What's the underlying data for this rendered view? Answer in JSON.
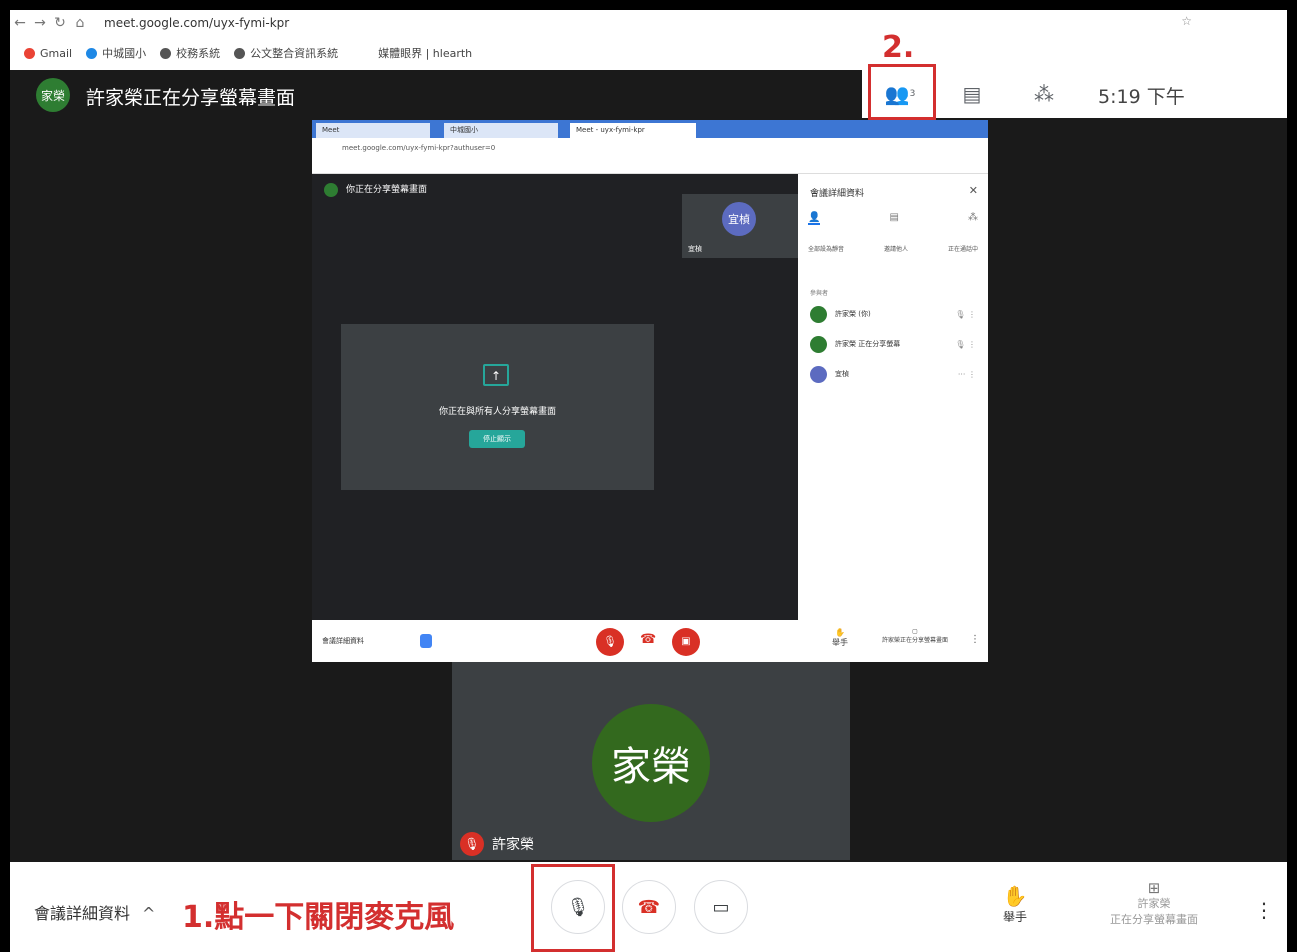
{
  "browser": {
    "url": "meet.google.com/uyx-fymi-kpr",
    "bookmarks": [
      "Gmail",
      "中城國小",
      "校務系統",
      "公文整合資訊系統",
      "媒體眼界 | hlearth"
    ]
  },
  "topbar": {
    "avatar_text": "家榮",
    "share_title": "許家榮正在分享螢幕畫面",
    "people_icon_badge": "3",
    "time": "5:19 下午",
    "annotation": "2."
  },
  "shared_screen": {
    "tab_labels": [
      "Meet",
      "中城國小",
      "Meet - uyx-fymi-kpr"
    ],
    "url": "meet.google.com/uyx-fymi-kpr?authuser=0",
    "presenter_title": "你正在分享螢幕畫面",
    "tile_avatar": "宜楨",
    "tile_name": "宜楨",
    "sharing_message": "你正在與所有人分享螢幕畫面",
    "stop_button": "停止顯示",
    "side_panel_title": "會議詳細資料",
    "side_actions": [
      "全部設為靜音",
      "邀請他人",
      "正在通話中"
    ],
    "section_label": "參與者",
    "participants": [
      {
        "name": "許家榮 (你)",
        "color": "#2e7d32"
      },
      {
        "name": "許家榮 正在分享螢幕",
        "color": "#2e7d32"
      },
      {
        "name": "宜楨",
        "color": "#5c6bc0"
      }
    ],
    "bottom_details": "會議詳細資料",
    "raise_hand": "舉手",
    "present_label": "許家榮正在分享螢幕畫面"
  },
  "self_tile": {
    "avatar": "家榮",
    "name": "許家榮"
  },
  "bottombar": {
    "details_label": "會議詳細資料",
    "annotation": "1.點一下關閉麥克風",
    "raise_hand": "舉手",
    "present_line1": "許家榮",
    "present_line2": "正在分享螢幕畫面"
  },
  "colors": {
    "annotation_red": "#d32f2f",
    "meet_red": "#d93025",
    "avatar_green": "#2e7d32"
  }
}
